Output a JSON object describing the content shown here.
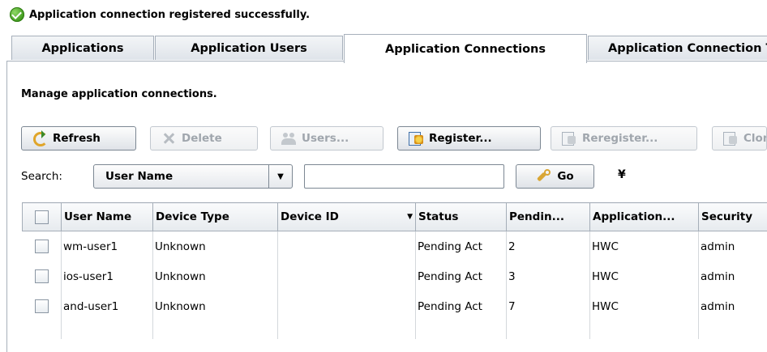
{
  "status": {
    "message": "Application connection registered successfully."
  },
  "tabs": [
    {
      "label": "Applications"
    },
    {
      "label": "Application Users"
    },
    {
      "label": "Application Connections"
    },
    {
      "label": "Application Connection Templates"
    }
  ],
  "description": "Manage application connections.",
  "toolbar": {
    "refresh": "Refresh",
    "delete": "Delete",
    "users": "Users...",
    "register": "Register...",
    "reregister": "Reregister...",
    "clone": "Clone..."
  },
  "search": {
    "label": "Search:",
    "field": "User Name",
    "value": "",
    "go": "Go"
  },
  "table": {
    "columns": [
      "User Name",
      "Device Type",
      "Device ID",
      "Status",
      "Pendin...",
      "Application...",
      "Security"
    ],
    "rows": [
      [
        "wm-user1",
        "Unknown",
        "",
        "Pending Act",
        "2",
        "HWC",
        "admin"
      ],
      [
        "ios-user1",
        "Unknown",
        "",
        "Pending Act",
        "3",
        "HWC",
        "admin"
      ],
      [
        "and-user1",
        "Unknown",
        "",
        "Pending Act",
        "7",
        "HWC",
        "admin"
      ]
    ]
  }
}
